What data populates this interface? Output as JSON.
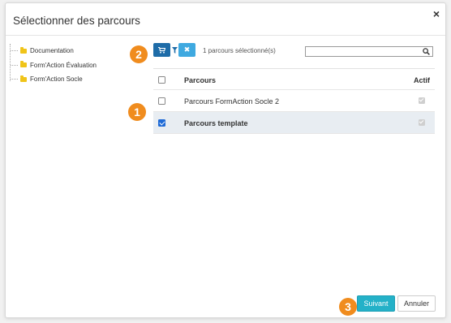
{
  "dialog": {
    "title": "Sélectionner des parcours",
    "close_label": "×"
  },
  "tree": {
    "items": [
      {
        "label": "Documentation",
        "icon": "folder-icon"
      },
      {
        "label": "Form'Action Évaluation",
        "icon": "folder-icon"
      },
      {
        "label": "Form'Action Socle",
        "icon": "folder-icon"
      }
    ]
  },
  "badges": {
    "b1": "1",
    "b2": "2",
    "b3": "3"
  },
  "toolbar": {
    "cart_icon": "cart-icon",
    "filter_icon": "filter-icon",
    "clear_icon": "close-icon",
    "clear_label": "✖",
    "selected_count": "1 parcours sélectionné(s)",
    "search_value": "",
    "search_icon": "search-icon"
  },
  "table": {
    "columns": [
      "Parcours",
      "Actif"
    ],
    "rows": [
      {
        "name": "Parcours FormAction Socle 2",
        "selected": false,
        "actif": true
      },
      {
        "name": "Parcours template",
        "selected": true,
        "actif": true
      }
    ]
  },
  "footer": {
    "next_label": "Suivant",
    "cancel_label": "Annuler"
  },
  "colors": {
    "badge": "#f08c1e",
    "primary_dark": "#1e6ca8",
    "primary_light": "#3fa9e0",
    "next_button": "#24b1c8",
    "selected_row": "#e8edf2",
    "folder": "#f0c419"
  }
}
